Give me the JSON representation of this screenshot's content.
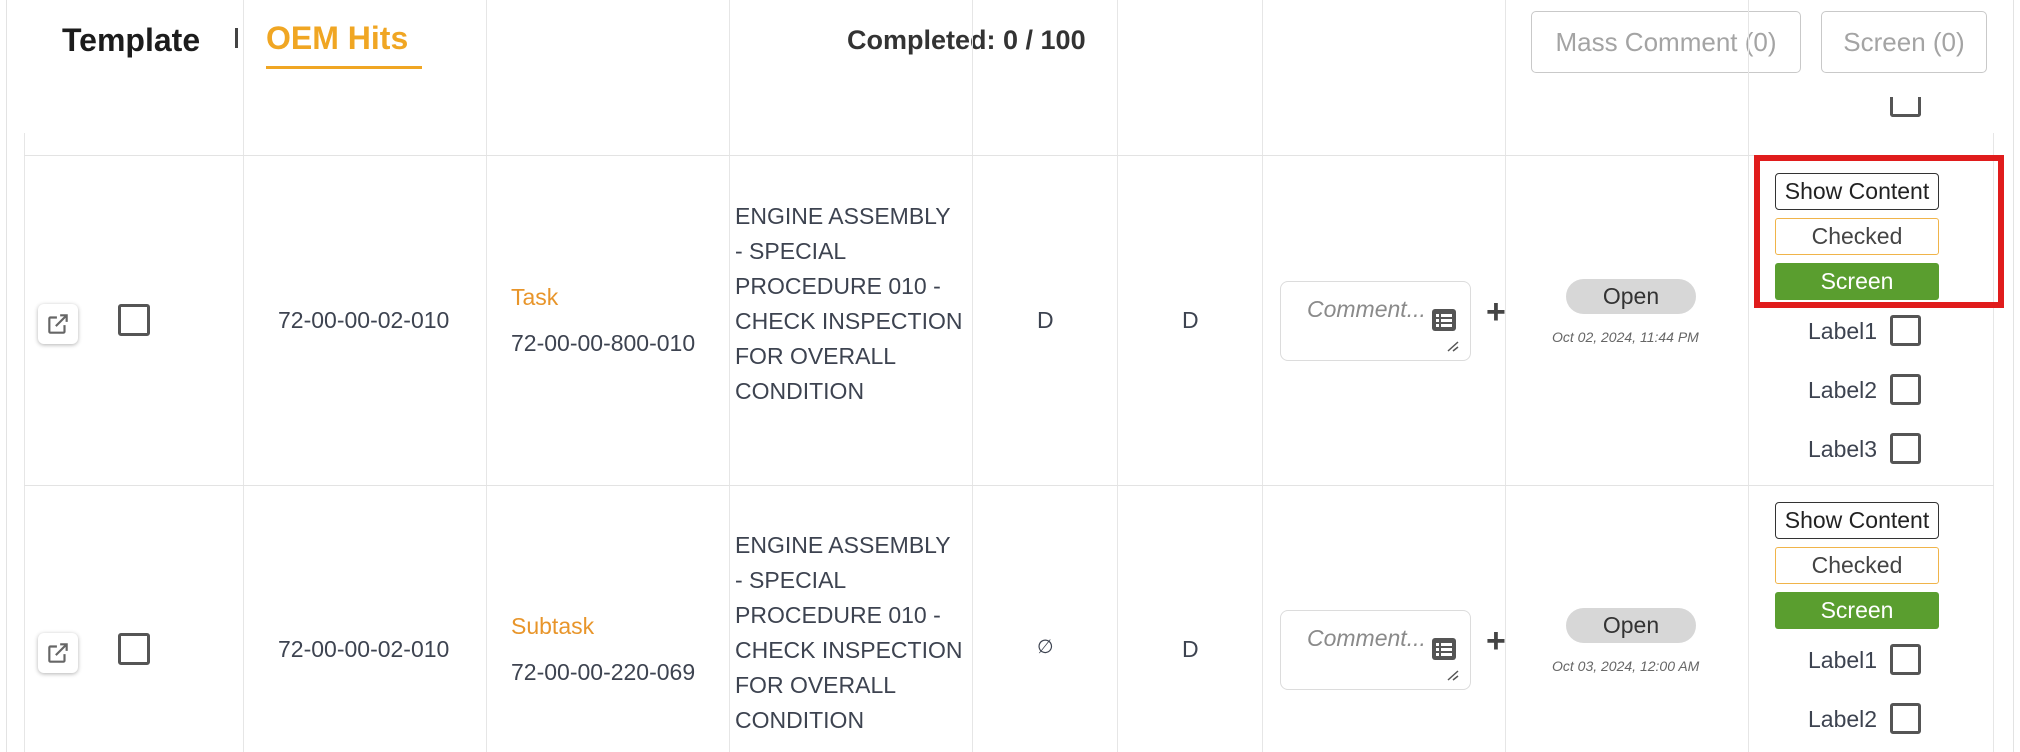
{
  "header": {
    "tab_template": "Template",
    "tab_oem_hits": "OEM Hits",
    "completed_label": "Completed:",
    "completed_value": "0 / 100",
    "mass_comment_button": "Mass Comment (0)",
    "screen_button": "Screen (0)"
  },
  "rows": [
    {
      "ref": "72-00-00-02-010",
      "type": "Task",
      "task_number": "72-00-00-800-010",
      "description": "ENGINE ASSEMBLY\n- SPECIAL\nPROCEDURE 010 -\nCHECK INSPECTION\nFOR OVERALL\nCONDITION",
      "col_a": "D",
      "col_b": "D",
      "comment_placeholder": "Comment...",
      "status": "Open",
      "status_date": "Oct 02, 2024, 11:44 PM",
      "actions": {
        "show_content": "Show Content",
        "checked": "Checked",
        "screen": "Screen"
      },
      "labels": [
        "Label1",
        "Label2",
        "Label3"
      ]
    },
    {
      "ref": "72-00-00-02-010",
      "type": "Subtask",
      "task_number": "72-00-00-220-069",
      "description": "ENGINE ASSEMBLY\n- SPECIAL\nPROCEDURE 010 -\nCHECK INSPECTION\nFOR OVERALL\nCONDITION",
      "col_a": "∅",
      "col_b": "D",
      "comment_placeholder": "Comment...",
      "status": "Open",
      "status_date": "Oct 03, 2024, 12:00 AM",
      "actions": {
        "show_content": "Show Content",
        "checked": "Checked",
        "screen": "Screen"
      },
      "labels": [
        "Label1",
        "Label2"
      ]
    }
  ],
  "colors": {
    "accent": "#f0a623",
    "screen_green": "#5a9e2f",
    "highlight_red": "#e01c1c",
    "status_pill": "#d7d7d7"
  }
}
